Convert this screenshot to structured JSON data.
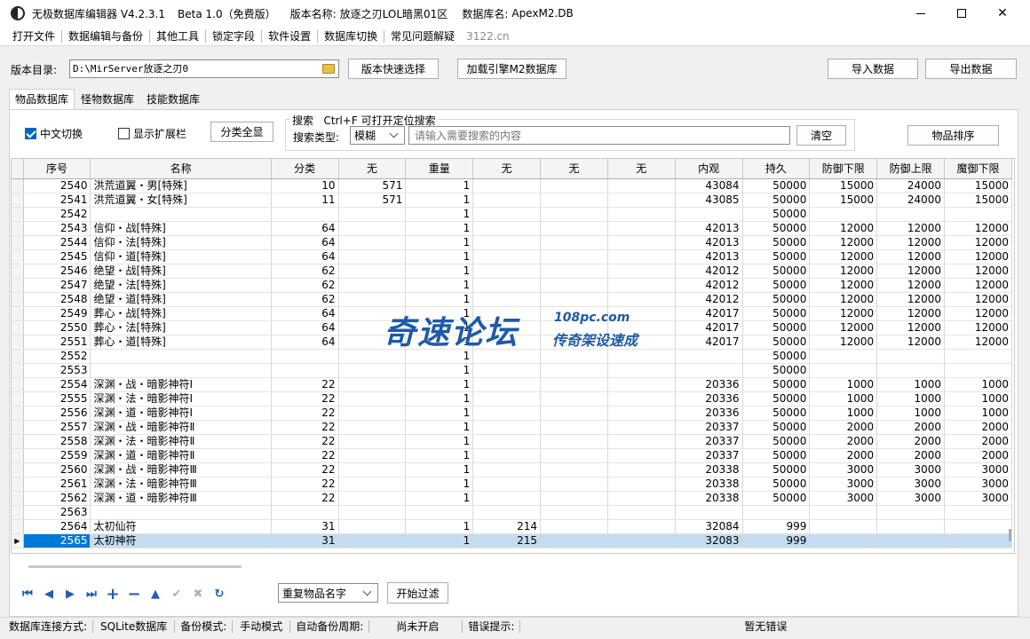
{
  "title": {
    "app": "无极数据库编辑器 V4.2.3.1",
    "edition": "Beta 1.0（免费版）",
    "version_label": "版本名称:",
    "version_value": "放逐之刃LOL暗黑01区",
    "db_label": "数据库名:",
    "db_value": "ApexM2.DB"
  },
  "menu": [
    "打开文件",
    "数据编辑与备份",
    "其他工具",
    "锁定字段",
    "软件设置",
    "数据库切换",
    "常见问题解疑"
  ],
  "menu_link": "3122.cn",
  "toolbar": {
    "dir_label": "版本目录:",
    "dir_value": "D:\\MirServer放逐之刃0",
    "quick_select": "版本快速选择",
    "load_engine": "加载引擎M2数据库",
    "import": "导入数据",
    "export": "导出数据"
  },
  "tabs": [
    "物品数据库",
    "怪物数据库",
    "技能数据库"
  ],
  "options": {
    "chinese_toggle": "中文切换",
    "chinese_checked": true,
    "show_ext": "显示扩展栏",
    "show_ext_checked": false,
    "show_all": "分类全显",
    "search_title": "搜索   Ctrl+F 可打开定位搜索",
    "search_type_label": "搜索类型:",
    "search_type_value": "模糊",
    "search_placeholder": "请输入需要搜索的内容",
    "clear": "清空",
    "sort": "物品排序"
  },
  "grid": {
    "columns": [
      "序号",
      "名称",
      "分类",
      "无",
      "重量",
      "无",
      "无",
      "无",
      "内观",
      "持久",
      "防御下限",
      "防御上限",
      "魔御下限"
    ],
    "rows": [
      [
        "2540",
        "洪荒道翼・男[特殊]",
        "10",
        "571",
        "1",
        "",
        "",
        "",
        "43084",
        "50000",
        "15000",
        "24000",
        "15000"
      ],
      [
        "2541",
        "洪荒道翼・女[特殊]",
        "11",
        "571",
        "1",
        "",
        "",
        "",
        "43085",
        "50000",
        "15000",
        "24000",
        "15000"
      ],
      [
        "2542",
        "",
        "",
        "",
        "1",
        "",
        "",
        "",
        "",
        "50000",
        "",
        "",
        ""
      ],
      [
        "2543",
        "信仰・战[特殊]",
        "64",
        "",
        "1",
        "",
        "",
        "",
        "42013",
        "50000",
        "12000",
        "12000",
        "12000"
      ],
      [
        "2544",
        "信仰・法[特殊]",
        "64",
        "",
        "1",
        "",
        "",
        "",
        "42013",
        "50000",
        "12000",
        "12000",
        "12000"
      ],
      [
        "2545",
        "信仰・道[特殊]",
        "64",
        "",
        "1",
        "",
        "",
        "",
        "42013",
        "50000",
        "12000",
        "12000",
        "12000"
      ],
      [
        "2546",
        "绝望・战[特殊]",
        "62",
        "",
        "1",
        "",
        "",
        "",
        "42012",
        "50000",
        "12000",
        "12000",
        "12000"
      ],
      [
        "2547",
        "绝望・法[特殊]",
        "62",
        "",
        "1",
        "",
        "",
        "",
        "42012",
        "50000",
        "12000",
        "12000",
        "12000"
      ],
      [
        "2548",
        "绝望・道[特殊]",
        "62",
        "",
        "1",
        "",
        "",
        "",
        "42012",
        "50000",
        "12000",
        "12000",
        "12000"
      ],
      [
        "2549",
        "葬心・战[特殊]",
        "64",
        "",
        "1",
        "",
        "",
        "",
        "42017",
        "50000",
        "12000",
        "12000",
        "12000"
      ],
      [
        "2550",
        "葬心・法[特殊]",
        "64",
        "",
        "1",
        "",
        "",
        "",
        "42017",
        "50000",
        "12000",
        "12000",
        "12000"
      ],
      [
        "2551",
        "葬心・道[特殊]",
        "64",
        "",
        "1",
        "",
        "",
        "",
        "42017",
        "50000",
        "12000",
        "12000",
        "12000"
      ],
      [
        "2552",
        "",
        "",
        "",
        "1",
        "",
        "",
        "",
        "",
        "50000",
        "",
        "",
        ""
      ],
      [
        "2553",
        "",
        "",
        "",
        "1",
        "",
        "",
        "",
        "",
        "50000",
        "",
        "",
        ""
      ],
      [
        "2554",
        "深渊・战・暗影神符Ⅰ",
        "22",
        "",
        "1",
        "",
        "",
        "",
        "20336",
        "50000",
        "1000",
        "1000",
        "1000"
      ],
      [
        "2555",
        "深渊・法・暗影神符Ⅰ",
        "22",
        "",
        "1",
        "",
        "",
        "",
        "20336",
        "50000",
        "1000",
        "1000",
        "1000"
      ],
      [
        "2556",
        "深渊・道・暗影神符Ⅰ",
        "22",
        "",
        "1",
        "",
        "",
        "",
        "20336",
        "50000",
        "1000",
        "1000",
        "1000"
      ],
      [
        "2557",
        "深渊・战・暗影神符Ⅱ",
        "22",
        "",
        "1",
        "",
        "",
        "",
        "20337",
        "50000",
        "2000",
        "2000",
        "2000"
      ],
      [
        "2558",
        "深渊・法・暗影神符Ⅱ",
        "22",
        "",
        "1",
        "",
        "",
        "",
        "20337",
        "50000",
        "2000",
        "2000",
        "2000"
      ],
      [
        "2559",
        "深渊・道・暗影神符Ⅱ",
        "22",
        "",
        "1",
        "",
        "",
        "",
        "20337",
        "50000",
        "2000",
        "2000",
        "2000"
      ],
      [
        "2560",
        "深渊・战・暗影神符Ⅲ",
        "22",
        "",
        "1",
        "",
        "",
        "",
        "20338",
        "50000",
        "3000",
        "3000",
        "3000"
      ],
      [
        "2561",
        "深渊・法・暗影神符Ⅲ",
        "22",
        "",
        "1",
        "",
        "",
        "",
        "20338",
        "50000",
        "3000",
        "3000",
        "3000"
      ],
      [
        "2562",
        "深渊・道・暗影神符Ⅲ",
        "22",
        "",
        "1",
        "",
        "",
        "",
        "20338",
        "50000",
        "3000",
        "3000",
        "3000"
      ],
      [
        "2563",
        "",
        "",
        "",
        "",
        "",
        "",
        "",
        "",
        "",
        "",
        "",
        ""
      ],
      [
        "2564",
        "太初仙符",
        "31",
        "",
        "1",
        "214",
        "",
        "",
        "32084",
        "999",
        "",
        "",
        ""
      ],
      [
        "2565",
        "太初神符",
        "31",
        "",
        "1",
        "215",
        "",
        "",
        "32083",
        "999",
        "",
        "",
        ""
      ]
    ],
    "selected_index": 25
  },
  "watermark": {
    "main": "奇速论坛",
    "site": "108pc.com",
    "sub": "传奇架设速成"
  },
  "bottom": {
    "filter_select": "重复物品名字",
    "filter_button": "开始过滤"
  },
  "status": {
    "conn_label": "数据库连接方式:",
    "conn_value": "SQLite数据库",
    "backup_label": "备份模式:",
    "backup_value": "手动模式",
    "auto_label": "自动备份周期:",
    "auto_value": "尚未开启",
    "error_label": "错误提示:",
    "error_value": "暂无错误"
  }
}
